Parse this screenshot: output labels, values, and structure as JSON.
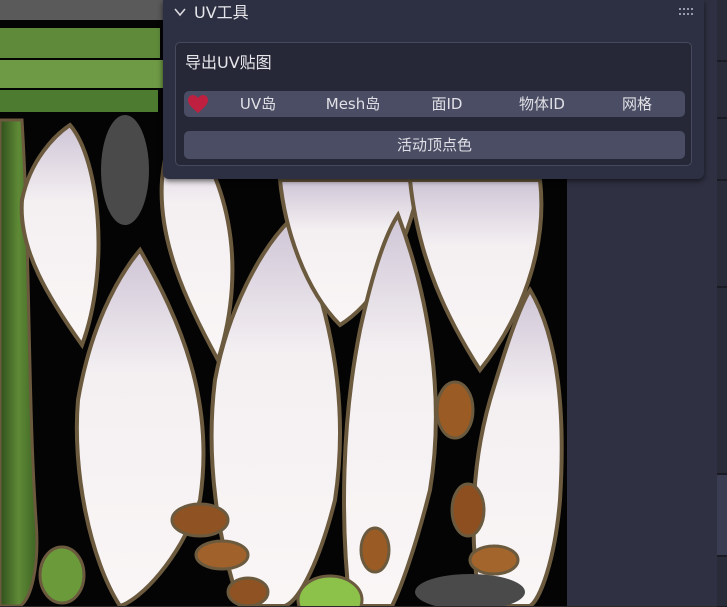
{
  "panel": {
    "title": "UV工具",
    "section": {
      "title": "导出UV贴图",
      "buttons": [
        "UV岛",
        "Mesh岛",
        "面ID",
        "物体ID",
        "网格"
      ],
      "action_button": "活动顶点色"
    }
  },
  "colors": {
    "panel_bg": "#2d2f43",
    "button_bg": "#4a4d63",
    "heart": "#c02040",
    "petal": "#f2eeef",
    "petal_outline": "#6b5a3e",
    "leaf": "#4f7a2e",
    "seed": "#9a5c24"
  },
  "icons": {
    "collapse": "chevron-down-icon",
    "drag": "drag-handle-icon",
    "favorite": "heart-icon"
  }
}
